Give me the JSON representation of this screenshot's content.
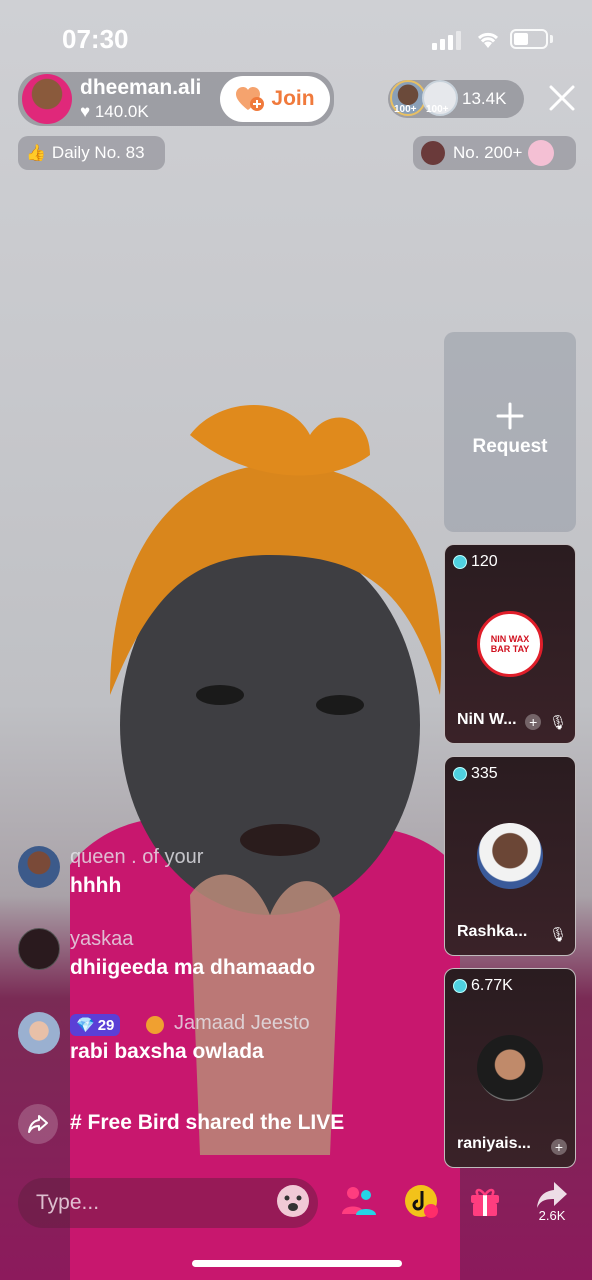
{
  "status_bar": {
    "time": "07:30"
  },
  "host": {
    "name": "dheeman.ali",
    "likes": "140.0K",
    "join_label": "Join"
  },
  "viewers": {
    "badge_1": "100+",
    "badge_2": "100+",
    "count": "13.4K"
  },
  "badges": {
    "daily": "Daily No. 83",
    "rank": "No. 200+"
  },
  "request": {
    "label": "Request"
  },
  "guests": [
    {
      "score": "120",
      "name": "NiN W...",
      "logo_text": "NIN WAX BAR TAY"
    },
    {
      "score": "335",
      "name": "Rashka..."
    },
    {
      "score": "6.77K",
      "name": "raniyais..."
    }
  ],
  "comments": [
    {
      "user": "queen . of your",
      "text": "hhhh"
    },
    {
      "user": "yaskaa",
      "text": "dhiigeeda ma dhamaado"
    },
    {
      "level": "29",
      "user": "Jamaad Jeesto",
      "text": "rabi baxsha owlada"
    }
  ],
  "share_event": {
    "text": "# Free Bird shared the LIVE"
  },
  "bottom_bar": {
    "placeholder": "Type...",
    "share_count": "2.6K"
  },
  "colors": {
    "accent": "#f07a3c",
    "magenta": "#e0287a",
    "gem": "#4fd1e0"
  }
}
